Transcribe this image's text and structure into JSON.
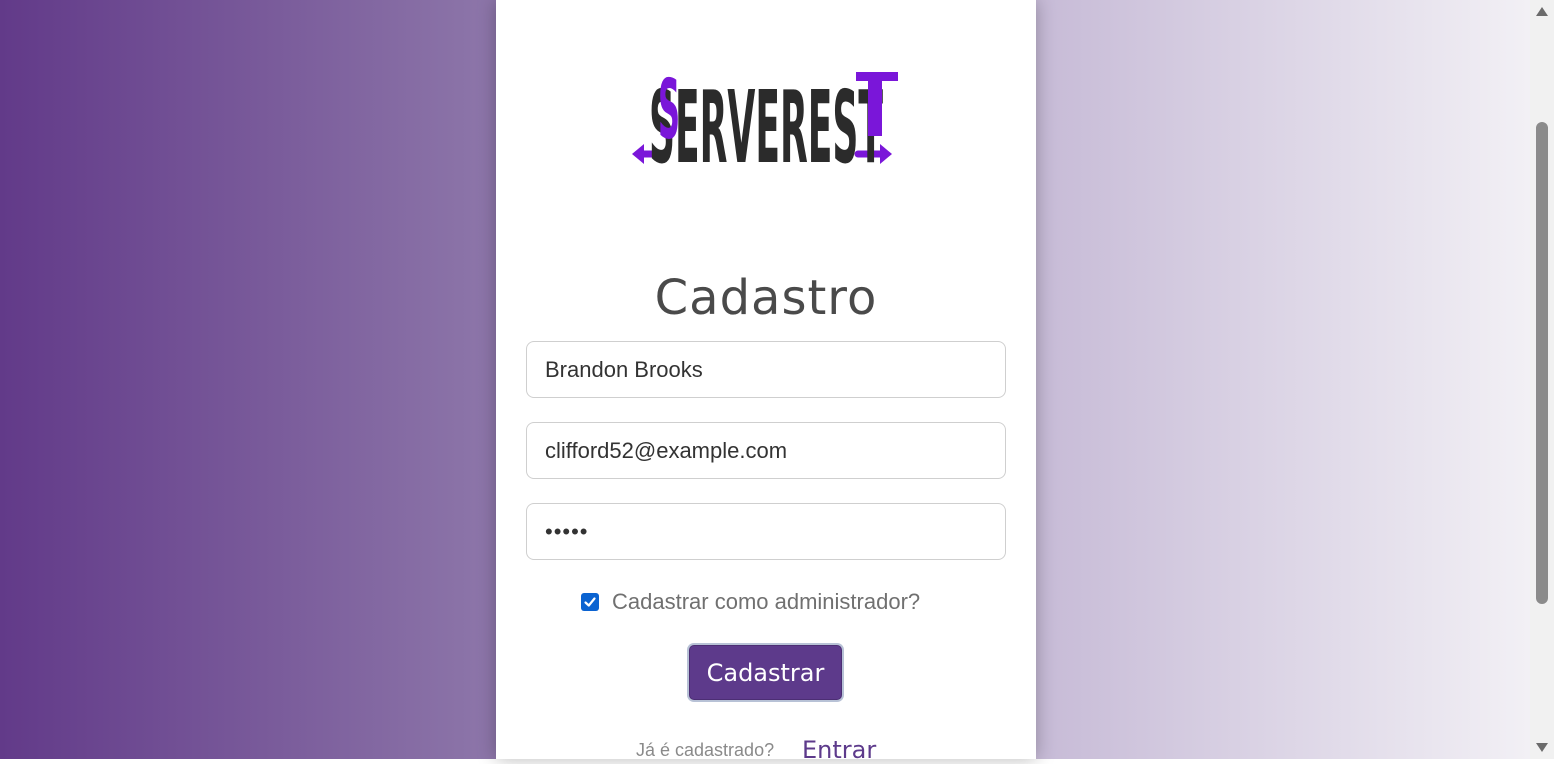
{
  "brand": {
    "logo_text": "SERVEREST",
    "colors": {
      "accent": "#7a16d9",
      "dark": "#2b2b2b"
    }
  },
  "form": {
    "title": "Cadastro",
    "nome_value": "Brandon Brooks",
    "email_value": "clifford52@example.com",
    "password_value": "•••••",
    "admin_checked": true,
    "admin_label": "Cadastrar como administrador?",
    "submit_label": "Cadastrar"
  },
  "footer": {
    "already_text": "Já é cadastrado?",
    "login_link": "Entrar"
  },
  "colors": {
    "primary": "#5d3a8b",
    "checkbox": "#0b63d1",
    "gradient_start": "#623a89",
    "gradient_end": "#f2f0f5"
  },
  "icons": {
    "checkbox": "check-icon",
    "scroll_up": "triangle-up-icon",
    "scroll_down": "triangle-down-icon"
  }
}
